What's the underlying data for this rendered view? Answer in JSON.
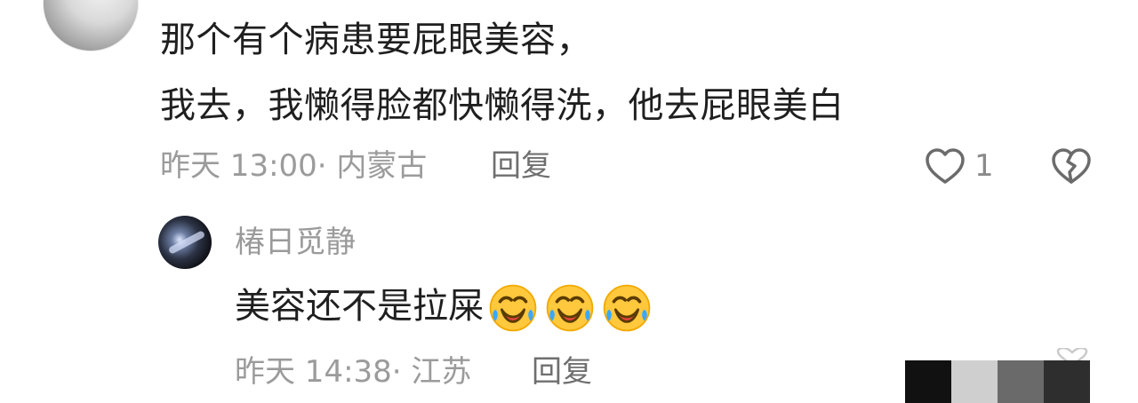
{
  "comment": {
    "line1": "那个有个病患要屁眼美容，",
    "line2": "我去，我懒得脸都快懒得洗，他去屁眼美白",
    "time": "昨天 13:00",
    "sep": "·",
    "location": "内蒙古",
    "reply_label": "回复",
    "like_count": "1",
    "icons": {
      "like": "heart-outline-icon",
      "dislike": "broken-heart-icon"
    }
  },
  "reply": {
    "username": "椿日觅静",
    "text": "美容还不是拉屎",
    "emojis": [
      "laughing-crying-emoji",
      "laughing-crying-emoji",
      "laughing-crying-emoji"
    ],
    "time": "昨天 14:38",
    "sep": "·",
    "location": "江苏",
    "reply_label": "回复"
  },
  "colors": {
    "text_primary": "#1f1f1f",
    "text_meta": "#9b9b9b",
    "text_action": "#6f6f6f",
    "emoji_yellow": "#FFC83D",
    "emoji_blue": "#3BA7FF",
    "emoji_red": "#E3453F"
  }
}
